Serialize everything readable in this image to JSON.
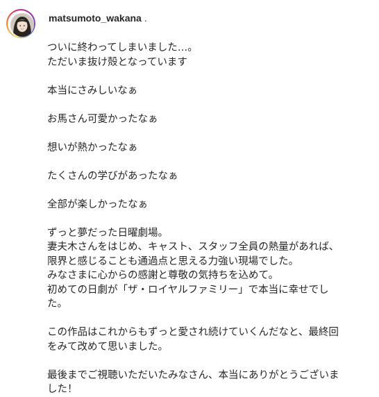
{
  "post": {
    "username": "matsumoto_wakana",
    "separator": ".",
    "caption_paragraphs": [
      "ついに終わってしまいました…。\nただいま抜け殻となっています",
      "本当にさみしいなぁ",
      "お馬さん可愛かったなぁ",
      "想いが熱かったなぁ",
      "たくさんの学びがあったなぁ",
      "全部が楽しかったなぁ",
      "ずっと夢だった日曜劇場。\n妻夫木さんをはじめ、キャスト、スタッフ全員の熱量があれば、\n限界と感じることも通過点と思える力強い現場でした。\nみなさまに心からの感謝と尊敬の気持ちを込めて。\n初めての日劇が「ザ・ロイヤルファミリー」で本当に幸せでし\nた。",
      "この作品はこれからもずっと愛され続けていくんだなと、最終回\nをみて改めて思いました。",
      "最後までご視聴いただいたみなさん、本当にありがとうございま\nした！"
    ]
  },
  "avatar": {
    "icon": "profile-photo-icon",
    "ring_colors": [
      "#feda75",
      "#fa7e1e",
      "#d62976",
      "#962fbf",
      "#4f5bd5"
    ]
  }
}
